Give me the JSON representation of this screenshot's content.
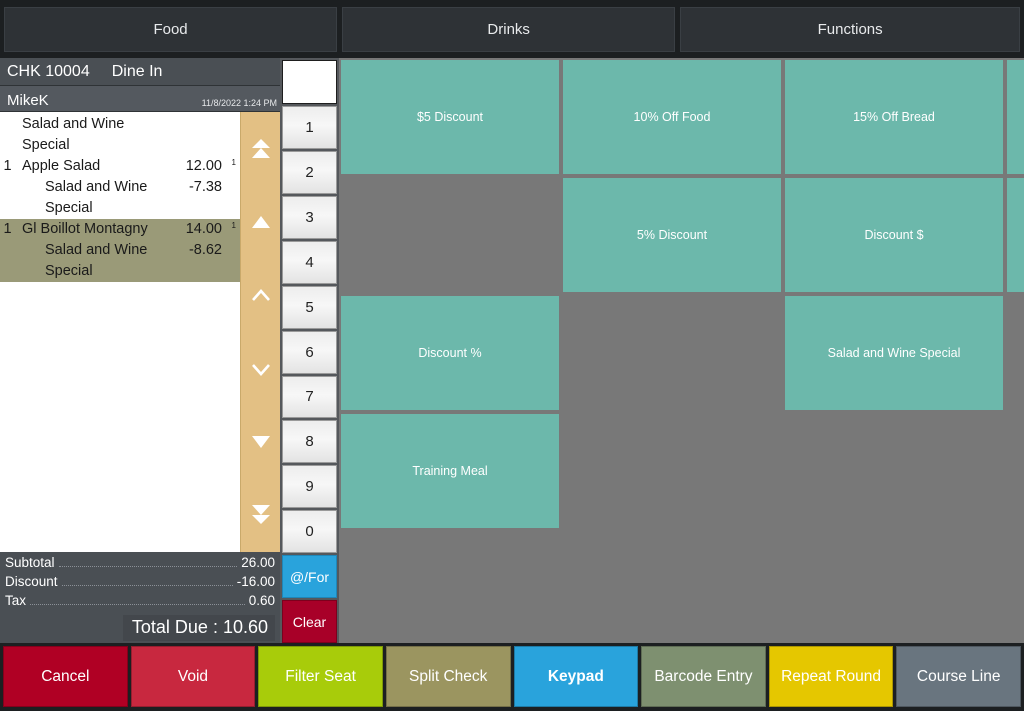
{
  "tabs": [
    {
      "label": "Food"
    },
    {
      "label": "Drinks"
    },
    {
      "label": "Functions"
    }
  ],
  "check": {
    "number": "CHK 10004",
    "order_type": "Dine In",
    "server": "MikeK",
    "timestamp": "11/8/2022 1:24 PM"
  },
  "order_lines": [
    {
      "qty": "",
      "name": "Salad and Wine Special",
      "amount": "",
      "seat": "",
      "kind": "group",
      "selected": false
    },
    {
      "qty": "1",
      "name": "Apple Salad",
      "amount": "12.00",
      "seat": "1",
      "kind": "item",
      "selected": false
    },
    {
      "qty": "",
      "name": "Salad and Wine",
      "amount": "-7.38",
      "seat": "",
      "kind": "modifier",
      "selected": false
    },
    {
      "qty": "",
      "name": "Special",
      "amount": "",
      "seat": "",
      "kind": "modifier",
      "selected": false
    },
    {
      "qty": "1",
      "name": "Gl Boillot Montagny",
      "amount": "14.00",
      "seat": "1",
      "kind": "item",
      "selected": true
    },
    {
      "qty": "",
      "name": "Salad and Wine",
      "amount": "-8.62",
      "seat": "",
      "kind": "modifier",
      "selected": true
    },
    {
      "qty": "",
      "name": "Special",
      "amount": "",
      "seat": "",
      "kind": "modifier",
      "selected": true
    }
  ],
  "scroll_controls": [
    {
      "icon": "double-chevron-up-icon"
    },
    {
      "icon": "triangle-up-icon"
    },
    {
      "icon": "chevron-up-icon"
    },
    {
      "icon": "chevron-down-icon"
    },
    {
      "icon": "triangle-down-icon"
    },
    {
      "icon": "double-chevron-down-icon"
    }
  ],
  "totals": {
    "subtotal_label": "Subtotal",
    "subtotal_value": "26.00",
    "discount_label": "Discount",
    "discount_value": "-16.00",
    "tax_label": "Tax",
    "tax_value": "0.60",
    "total_due_label": "Total Due",
    "total_due_separator": ":",
    "total_due_value": "10.60"
  },
  "keypad": {
    "display_value": "",
    "keys": [
      "1",
      "2",
      "3",
      "4",
      "5",
      "6",
      "7",
      "8",
      "9",
      "0"
    ],
    "at_for_label": "@/For",
    "clear_label": "Clear"
  },
  "tiles": [
    {
      "label": "$5 Discount"
    },
    {
      "label": "10% Off Food"
    },
    {
      "label": "15% Off Bread"
    },
    {
      "label": ""
    },
    {
      "label": "5% Discount"
    },
    {
      "label": "Discount $"
    },
    {
      "label": "Discount %"
    },
    {
      "label": ""
    },
    {
      "label": "Salad and Wine Special"
    },
    {
      "label": "Training Meal"
    }
  ],
  "actions": [
    {
      "label": "Cancel",
      "style": "cancel"
    },
    {
      "label": "Void",
      "style": "void"
    },
    {
      "label": "Filter Seat",
      "style": "filter"
    },
    {
      "label": "Split Check",
      "style": "split"
    },
    {
      "label": "Keypad",
      "style": "keypadb"
    },
    {
      "label": "Barcode Entry",
      "style": "barcode"
    },
    {
      "label": "Repeat Round",
      "style": "repeat"
    },
    {
      "label": "Course Line",
      "style": "course"
    }
  ],
  "colors": {
    "tile_teal": "#6cb8ab",
    "selected_row": "#9a9a78",
    "scroll_strip": "#e3c084",
    "accent_blue": "#29a3dc",
    "clear_red": "#a80028",
    "background_gray": "#787878"
  }
}
